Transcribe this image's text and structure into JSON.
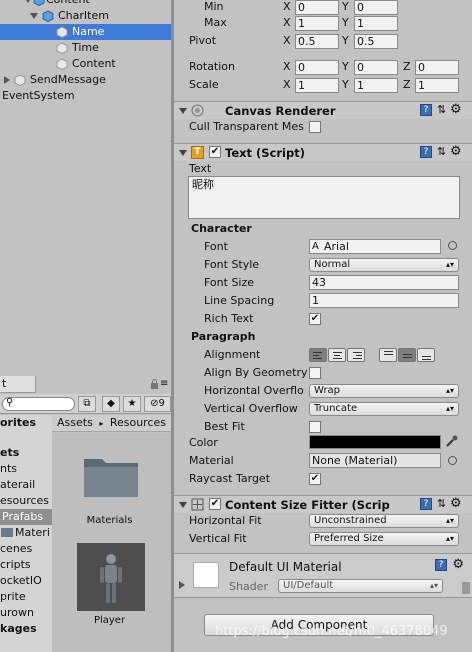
{
  "hierarchy": {
    "items": [
      {
        "label": "Content",
        "state": "expanded"
      },
      {
        "label": "CharItem",
        "state": "expanded"
      },
      {
        "label": "Name",
        "state": "leaf"
      },
      {
        "label": "Time",
        "state": "leaf"
      },
      {
        "label": "Content",
        "state": "leaf"
      },
      {
        "label": "SendMessage",
        "state": "collapsed"
      },
      {
        "label": "EventSystem",
        "state": "none"
      }
    ],
    "selected": "Name"
  },
  "project": {
    "tab_label": "t",
    "toolbar_count": "9",
    "favorites_header": "orites",
    "favorites": [
      {
        "label": "ets",
        "bold": true
      },
      {
        "label": "nts"
      },
      {
        "label": "aterail"
      },
      {
        "label": "esources"
      },
      {
        "label": "Prafabs",
        "selected": true
      },
      {
        "label": "Materi"
      },
      {
        "label": "cenes"
      },
      {
        "label": "cripts"
      },
      {
        "label": "ocketIO"
      },
      {
        "label": "prite"
      },
      {
        "label": "urown"
      },
      {
        "label": "kages",
        "bold": true
      }
    ],
    "breadcrumb": {
      "root": "Assets",
      "sep": "▸",
      "current": "Resources"
    },
    "assets": [
      {
        "label": "Materials",
        "icon": "folder-icon"
      },
      {
        "label": "Player",
        "icon": "prefab-thumbnail"
      }
    ]
  },
  "inspector": {
    "rect": {
      "min": {
        "label": "Min",
        "x": "0",
        "y": "0"
      },
      "max": {
        "label": "Max",
        "x": "1",
        "y": "1"
      },
      "pivot": {
        "label": "Pivot",
        "x": "0.5",
        "y": "0.5"
      },
      "rotation": {
        "label": "Rotation",
        "x": "0",
        "y": "0",
        "z": "0"
      },
      "scale": {
        "label": "Scale",
        "x": "1",
        "y": "1",
        "z": "1"
      }
    },
    "axis": {
      "x": "X",
      "y": "Y",
      "z": "Z"
    },
    "canvas_renderer": {
      "title": "Canvas Renderer",
      "cull_label": "Cull Transparent Mes"
    },
    "text_script": {
      "title": "Text (Script)",
      "text_label": "Text",
      "text_value": "昵称",
      "character_header": "Character",
      "font_label": "Font",
      "font_value": "Arial",
      "font_style_label": "Font Style",
      "font_style_value": "Normal",
      "font_size_label": "Font Size",
      "font_size_value": "43",
      "line_spacing_label": "Line Spacing",
      "line_spacing_value": "1",
      "rich_text_label": "Rich Text",
      "paragraph_header": "Paragraph",
      "alignment_label": "Alignment",
      "align_geometry_label": "Align By Geometry",
      "h_overflow_label": "Horizontal Overflo",
      "h_overflow_value": "Wrap",
      "v_overflow_label": "Vertical Overflow",
      "v_overflow_value": "Truncate",
      "best_fit_label": "Best Fit",
      "color_label": "Color",
      "color_value": "#000000",
      "material_label": "Material",
      "material_value": "None (Material)",
      "raycast_label": "Raycast Target"
    },
    "content_size_fitter": {
      "title": "Content Size Fitter (Scrip",
      "h_fit_label": "Horizontal Fit",
      "h_fit_value": "Unconstrained",
      "v_fit_label": "Vertical Fit",
      "v_fit_value": "Preferred Size"
    },
    "material_preview": {
      "name": "Default UI Material",
      "shader_label": "Shader",
      "shader_value": "UI/Default"
    },
    "add_component_label": "Add Component"
  },
  "watermark": "https://blog.csdn.net/m0_46378049",
  "colors": {
    "selection": "#3d7bd6",
    "panel": "#c2c2c2"
  }
}
